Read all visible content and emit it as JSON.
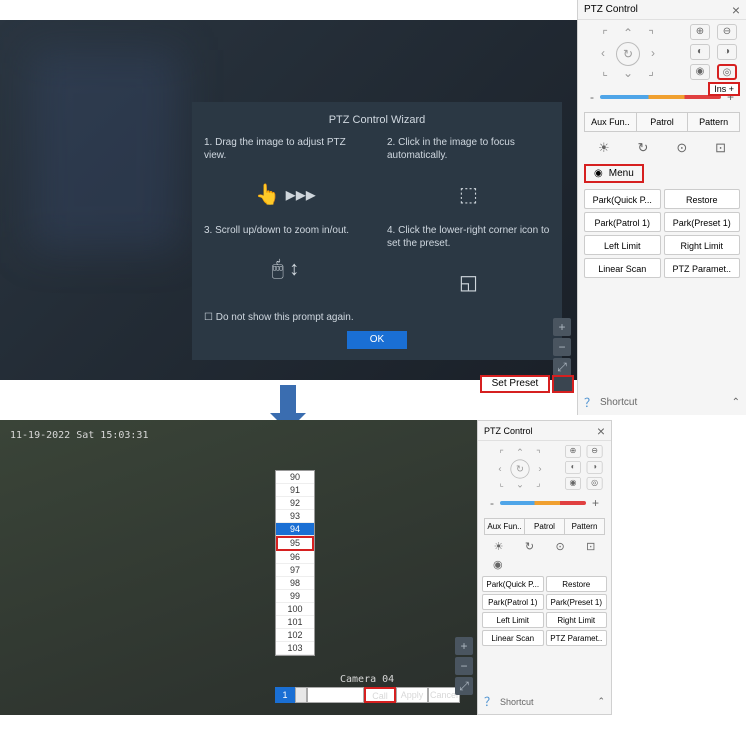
{
  "ptz_panel": {
    "title": "PTZ Control",
    "ins_label": "Ins +",
    "speed_minus": "-",
    "speed_plus": "+",
    "tabs": [
      "Aux Fun..",
      "Patrol",
      "Pattern"
    ],
    "menu_label": "Menu",
    "buttons": [
      "Park(Quick P...",
      "Restore",
      "Park(Patrol 1)",
      "Park(Preset 1)",
      "Left Limit",
      "Right Limit",
      "Linear Scan",
      "PTZ Paramet.."
    ],
    "shortcut": "Shortcut"
  },
  "wizard": {
    "title": "PTZ Control Wizard",
    "step1": "1. Drag the image to adjust PTZ view.",
    "step2": "2. Click in the image to focus automatically.",
    "step3": "3. Scroll up/down to zoom in/out.",
    "step4": "4. Click the lower-right corner icon to set the preset.",
    "dont_show": "Do not show this prompt again.",
    "ok": "OK"
  },
  "set_preset": "Set Preset",
  "bottom": {
    "timestamp": "11-19-2022 Sat 15:03:31",
    "camera": "Camera 04",
    "preset_list": [
      "90",
      "91",
      "92",
      "93",
      "94",
      "95",
      "96",
      "97",
      "98",
      "99",
      "100",
      "101",
      "102",
      "103"
    ],
    "selected": "94",
    "highlighted": "95",
    "ctrl_num": "1",
    "call": "Call",
    "apply": "Apply",
    "cancel": "Cancel"
  }
}
